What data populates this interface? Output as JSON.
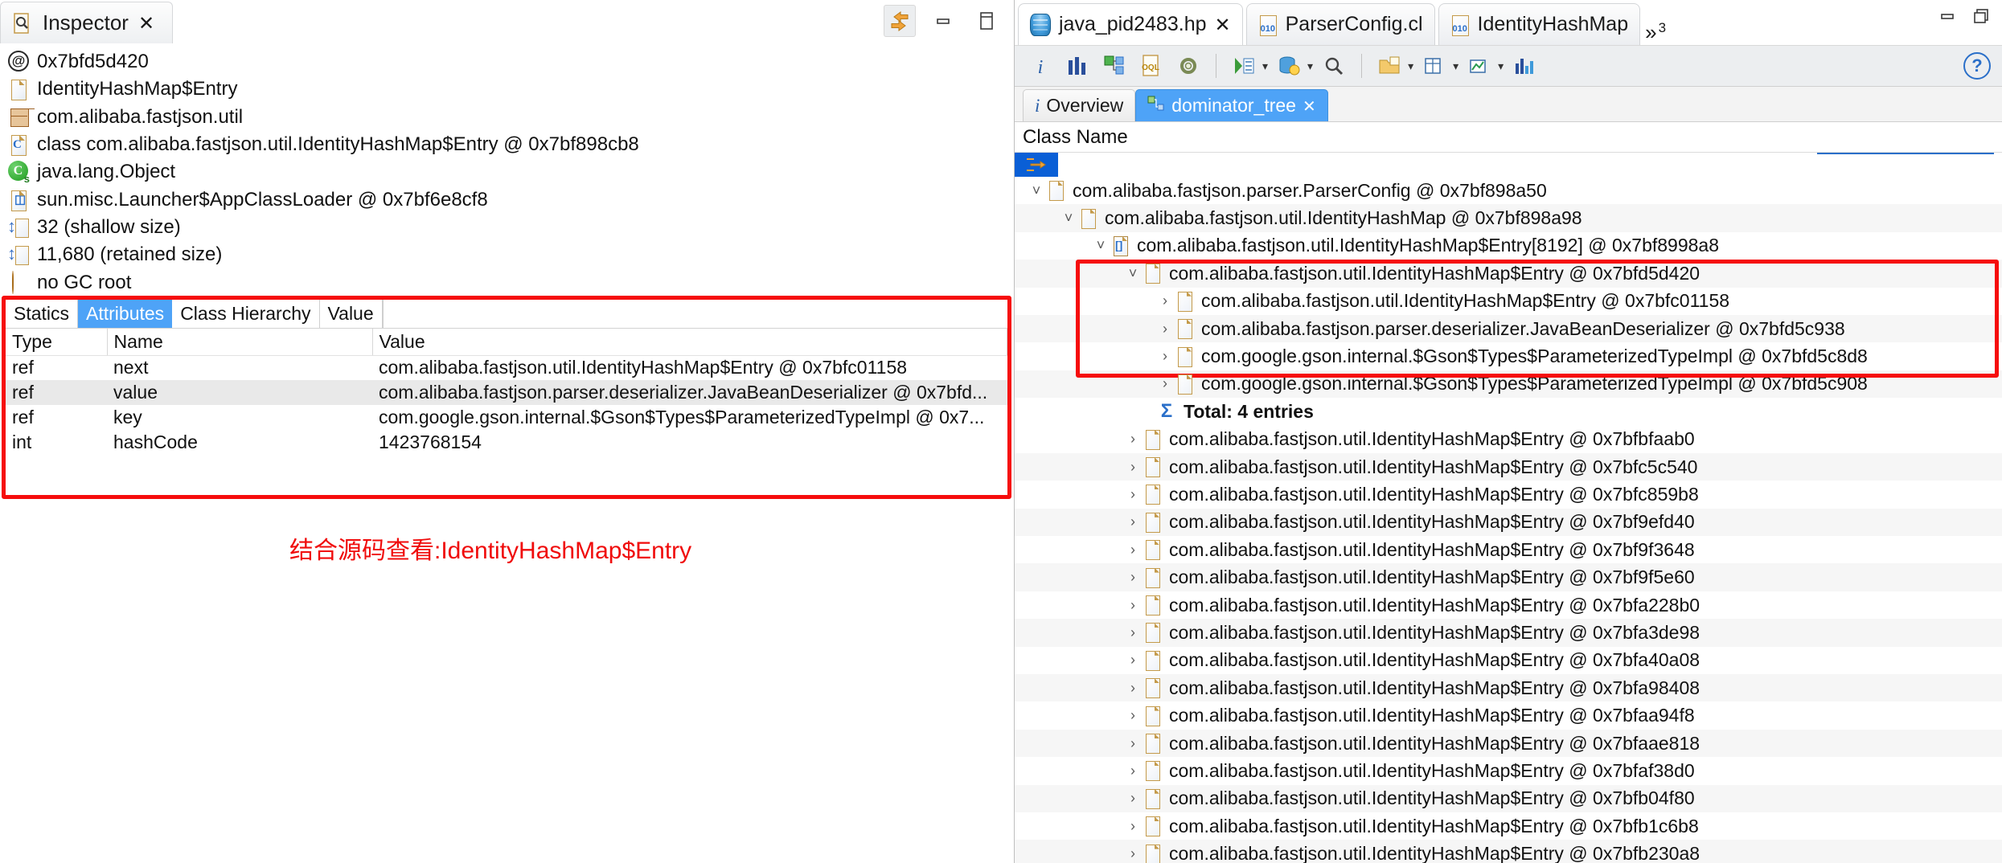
{
  "inspector": {
    "tab_title": "Inspector",
    "close_icon": "✕",
    "toolbar": {
      "link_icon": "link-with-editor-icon",
      "minimize_icon": "▬",
      "maximize_icon": "▭"
    },
    "items": [
      {
        "icon": "at-icon",
        "label": "0x7bfd5d420"
      },
      {
        "icon": "class-doc-icon",
        "label": "IdentityHashMap$Entry"
      },
      {
        "icon": "package-icon",
        "label": "com.alibaba.fastjson.util"
      },
      {
        "icon": "class-file-icon",
        "label": "class com.alibaba.fastjson.util.IdentityHashMap$Entry @ 0x7bf898cb8"
      },
      {
        "icon": "superclass-icon",
        "label": "java.lang.Object"
      },
      {
        "icon": "classloader-icon",
        "label": "sun.misc.Launcher$AppClassLoader @ 0x7bf6e8cf8"
      },
      {
        "icon": "shallow-size-icon",
        "label": "32 (shallow size)"
      },
      {
        "icon": "retained-size-icon",
        "label": "11,680 (retained size)"
      },
      {
        "icon": "gc-root-icon",
        "label": "no GC root"
      }
    ],
    "attributes_panel": {
      "tabs": [
        {
          "label": "Statics",
          "selected": false
        },
        {
          "label": "Attributes",
          "selected": true
        },
        {
          "label": "Class Hierarchy",
          "selected": false
        },
        {
          "label": "Value",
          "selected": false
        }
      ],
      "columns": [
        "Type",
        "Name",
        "Value"
      ],
      "rows": [
        {
          "type": "ref",
          "name": "next",
          "value": "com.alibaba.fastjson.util.IdentityHashMap$Entry @ 0x7bfc01158"
        },
        {
          "type": "ref",
          "name": "value",
          "value": "com.alibaba.fastjson.parser.deserializer.JavaBeanDeserializer @ 0x7bfd..."
        },
        {
          "type": "ref",
          "name": "key",
          "value": "com.google.gson.internal.$Gson$Types$ParameterizedTypeImpl @ 0x7..."
        },
        {
          "type": "int",
          "name": "hashCode",
          "value": "1423768154"
        }
      ]
    },
    "annotation": "结合源码查看:IdentityHashMap$Entry",
    "annotation_color": "#f00b0b",
    "highlight_color": "#f60d0d"
  },
  "editor": {
    "tabs": [
      {
        "icon": "heap-dump-icon",
        "label": "java_pid2483.hp",
        "close_icon": "✕",
        "active": true
      },
      {
        "icon": "binary-file-icon",
        "label": "ParserConfig.cl",
        "active": false
      },
      {
        "icon": "binary-file-icon",
        "label": "IdentityHashMap",
        "active": false
      }
    ],
    "more_tabs": {
      "symbol": "»",
      "count": "3"
    },
    "window_controls": {
      "minimize": "▬",
      "restore": "❐"
    },
    "toolbar": [
      {
        "name": "info-icon",
        "glyph": "i"
      },
      {
        "name": "histogram-icon",
        "glyph": "▎▌▎"
      },
      {
        "name": "dominator-tree-icon",
        "glyph": "tree"
      },
      {
        "name": "oql-icon",
        "glyph": "OQL"
      },
      {
        "name": "settings-gear-icon",
        "glyph": "gear"
      },
      {
        "name": "run-expert-system-icon",
        "glyph": "run",
        "caret": "▾"
      },
      {
        "name": "query-browser-icon",
        "glyph": "query",
        "caret": "▾"
      },
      {
        "name": "search-icon",
        "glyph": "search"
      },
      {
        "name": "open-folder-icon",
        "glyph": "folder",
        "caret": "▾"
      },
      {
        "name": "export-table-icon",
        "glyph": "table",
        "caret": "▾"
      },
      {
        "name": "export-chart-icon",
        "glyph": "chart",
        "caret": "▾"
      },
      {
        "name": "compare-icon",
        "glyph": "bars"
      }
    ],
    "help_icon": "?",
    "view_tabs": [
      {
        "label": "Overview",
        "icon": "info-icon",
        "selected": false
      },
      {
        "label": "dominator_tree",
        "icon": "dominator-tree-icon",
        "selected": true,
        "close_icon": "✕"
      }
    ],
    "column_header": "Class Name",
    "filter_placeholder": "",
    "tree_highlight_color": "#f60d0d",
    "tree_rows": [
      {
        "indent": 0,
        "twisty": "v",
        "icon": "class-doc-icon",
        "label": "com.alibaba.fastjson.parser.ParserConfig @ 0x7bf898a50",
        "highlighted": false,
        "alt": false
      },
      {
        "indent": 1,
        "twisty": "v",
        "icon": "class-doc-icon",
        "label": "com.alibaba.fastjson.util.IdentityHashMap @ 0x7bf898a98",
        "highlighted": false,
        "alt": true
      },
      {
        "indent": 2,
        "twisty": "v",
        "icon": "array-doc-icon",
        "label": "com.alibaba.fastjson.util.IdentityHashMap$Entry[8192] @ 0x7bf8998a8",
        "highlighted": false,
        "alt": false
      },
      {
        "indent": 3,
        "twisty": "v",
        "icon": "class-doc-icon",
        "label": "com.alibaba.fastjson.util.IdentityHashMap$Entry @ 0x7bfd5d420",
        "highlighted": true,
        "alt": true
      },
      {
        "indent": 4,
        "twisty": ">",
        "icon": "class-doc-icon",
        "label": "com.alibaba.fastjson.util.IdentityHashMap$Entry @ 0x7bfc01158",
        "highlighted": true,
        "alt": false
      },
      {
        "indent": 4,
        "twisty": ">",
        "icon": "class-doc-icon",
        "label": "com.alibaba.fastjson.parser.deserializer.JavaBeanDeserializer @ 0x7bfd5c938",
        "highlighted": true,
        "alt": true
      },
      {
        "indent": 4,
        "twisty": ">",
        "icon": "class-doc-icon",
        "label": "com.google.gson.internal.$Gson$Types$ParameterizedTypeImpl @ 0x7bfd5c8d8",
        "highlighted": true,
        "alt": false
      },
      {
        "indent": 4,
        "twisty": ">",
        "icon": "class-doc-icon",
        "label": "com.google.gson.internal.$Gson$Types$ParameterizedTypeImpl @ 0x7bfd5c908",
        "highlighted": true,
        "alt": true
      }
    ],
    "total_row": {
      "sigma": "Σ",
      "label": "Total: 4 entries",
      "indent": 4
    },
    "tree_rows_after": [
      {
        "indent": 3,
        "twisty": ">",
        "icon": "class-doc-icon",
        "label": "com.alibaba.fastjson.util.IdentityHashMap$Entry @ 0x7bfbfaab0",
        "alt": false
      },
      {
        "indent": 3,
        "twisty": ">",
        "icon": "class-doc-icon",
        "label": "com.alibaba.fastjson.util.IdentityHashMap$Entry @ 0x7bfc5c540",
        "alt": true
      },
      {
        "indent": 3,
        "twisty": ">",
        "icon": "class-doc-icon",
        "label": "com.alibaba.fastjson.util.IdentityHashMap$Entry @ 0x7bfc859b8",
        "alt": false
      },
      {
        "indent": 3,
        "twisty": ">",
        "icon": "class-doc-icon",
        "label": "com.alibaba.fastjson.util.IdentityHashMap$Entry @ 0x7bf9efd40",
        "alt": true
      },
      {
        "indent": 3,
        "twisty": ">",
        "icon": "class-doc-icon",
        "label": "com.alibaba.fastjson.util.IdentityHashMap$Entry @ 0x7bf9f3648",
        "alt": false
      },
      {
        "indent": 3,
        "twisty": ">",
        "icon": "class-doc-icon",
        "label": "com.alibaba.fastjson.util.IdentityHashMap$Entry @ 0x7bf9f5e60",
        "alt": true
      },
      {
        "indent": 3,
        "twisty": ">",
        "icon": "class-doc-icon",
        "label": "com.alibaba.fastjson.util.IdentityHashMap$Entry @ 0x7bfa228b0",
        "alt": false
      },
      {
        "indent": 3,
        "twisty": ">",
        "icon": "class-doc-icon",
        "label": "com.alibaba.fastjson.util.IdentityHashMap$Entry @ 0x7bfa3de98",
        "alt": true
      },
      {
        "indent": 3,
        "twisty": ">",
        "icon": "class-doc-icon",
        "label": "com.alibaba.fastjson.util.IdentityHashMap$Entry @ 0x7bfa40a08",
        "alt": false
      },
      {
        "indent": 3,
        "twisty": ">",
        "icon": "class-doc-icon",
        "label": "com.alibaba.fastjson.util.IdentityHashMap$Entry @ 0x7bfa98408",
        "alt": true
      },
      {
        "indent": 3,
        "twisty": ">",
        "icon": "class-doc-icon",
        "label": "com.alibaba.fastjson.util.IdentityHashMap$Entry @ 0x7bfaa94f8",
        "alt": false
      },
      {
        "indent": 3,
        "twisty": ">",
        "icon": "class-doc-icon",
        "label": "com.alibaba.fastjson.util.IdentityHashMap$Entry @ 0x7bfaae818",
        "alt": true
      },
      {
        "indent": 3,
        "twisty": ">",
        "icon": "class-doc-icon",
        "label": "com.alibaba.fastjson.util.IdentityHashMap$Entry @ 0x7bfaf38d0",
        "alt": false
      },
      {
        "indent": 3,
        "twisty": ">",
        "icon": "class-doc-icon",
        "label": "com.alibaba.fastjson.util.IdentityHashMap$Entry @ 0x7bfb04f80",
        "alt": true
      },
      {
        "indent": 3,
        "twisty": ">",
        "icon": "class-doc-icon",
        "label": "com.alibaba.fastjson.util.IdentityHashMap$Entry @ 0x7bfb1c6b8",
        "alt": false
      },
      {
        "indent": 3,
        "twisty": ">",
        "icon": "class-doc-icon",
        "label": "com.alibaba.fastjson.util.IdentityHashMap$Entry @ 0x7bfb230a8",
        "alt": true
      }
    ]
  }
}
